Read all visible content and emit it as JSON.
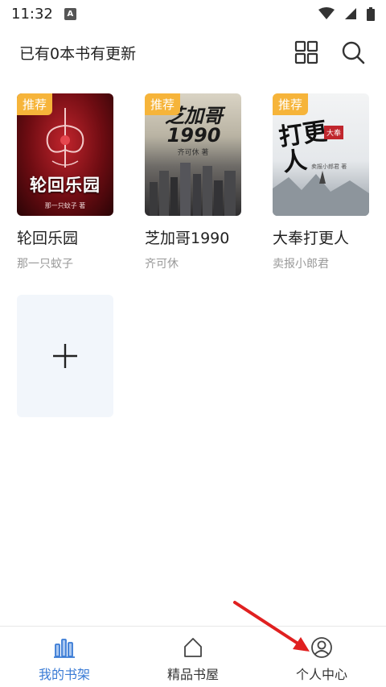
{
  "status_bar": {
    "time": "11:32",
    "notification_badge": "A",
    "icons": [
      "wifi-icon",
      "signal-icon",
      "battery-icon"
    ]
  },
  "header": {
    "update_text": "已有0本书有更新",
    "icons": [
      "grid-view-icon",
      "search-icon"
    ]
  },
  "books": [
    {
      "title": "轮回乐园",
      "author": "那一只蚊子",
      "tag": "推荐",
      "cover_title": "轮回乐园",
      "cover_byline": "那一只蚊子 著"
    },
    {
      "title": "芝加哥1990",
      "author": "齐可休",
      "tag": "推荐",
      "cover_title": "芝加哥 1990",
      "cover_byline": "齐可休 著"
    },
    {
      "title": "大奉打更人",
      "author": "卖报小郎君",
      "tag": "推荐",
      "cover_title": "打更人",
      "cover_badge": "大奉",
      "cover_byline": "卖报小郎君 著"
    }
  ],
  "add_book": {
    "icon": "plus-icon"
  },
  "bottom_nav": [
    {
      "label": "我的书架",
      "icon": "bookshelf-icon",
      "active": true
    },
    {
      "label": "精品书屋",
      "icon": "home-icon",
      "active": false
    },
    {
      "label": "个人中心",
      "icon": "user-icon",
      "active": false
    }
  ],
  "colors": {
    "accent": "#3a7bd5",
    "tag": "#f6b43a",
    "arrow": "#e02020",
    "add_card_bg": "#f2f6fb"
  }
}
